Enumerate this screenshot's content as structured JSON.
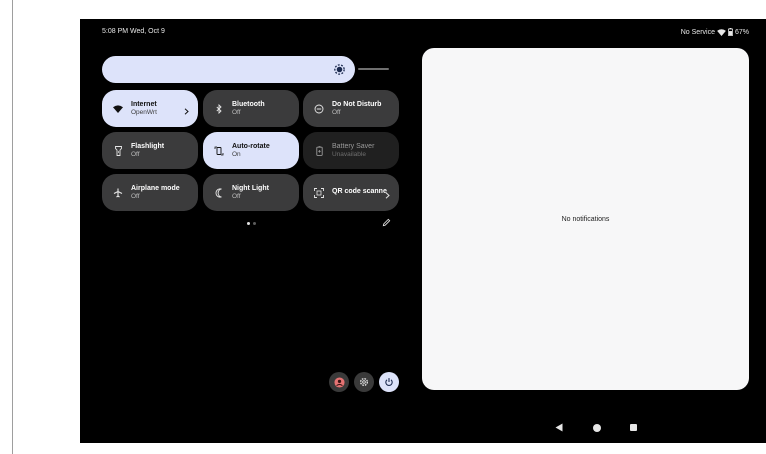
{
  "status_bar": {
    "time_date": "5:08 PM  Wed, Oct 9",
    "network": "No Service",
    "battery_percent": "67%",
    "battery_level": 0.67
  },
  "brightness": {
    "level": 0.97,
    "icon": "brightness-icon"
  },
  "tiles": [
    {
      "label": "Internet",
      "state": "OpenWrt",
      "icon": "wifi-icon",
      "active": true,
      "has_chevron": true
    },
    {
      "label": "Bluetooth",
      "state": "Off",
      "icon": "bluetooth-icon",
      "active": false
    },
    {
      "label": "Do Not Disturb",
      "state": "Off",
      "icon": "do-not-disturb-icon",
      "active": false
    },
    {
      "label": "Flashlight",
      "state": "Off",
      "icon": "flashlight-icon",
      "active": false
    },
    {
      "label": "Auto-rotate",
      "state": "On",
      "icon": "auto-rotate-icon",
      "active": true
    },
    {
      "label": "Battery Saver",
      "state": "Unavailable",
      "icon": "battery-saver-icon",
      "active": false,
      "unavailable": true
    },
    {
      "label": "Airplane mode",
      "state": "Off",
      "icon": "airplane-icon",
      "active": false
    },
    {
      "label": "Night Light",
      "state": "Off",
      "icon": "night-light-icon",
      "active": false
    },
    {
      "label": "QR code scanne",
      "state": "",
      "icon": "qr-code-icon",
      "active": false,
      "has_chevron": true
    }
  ],
  "pager": {
    "pages": 2,
    "current": 1
  },
  "actions": {
    "edit": "edit-icon",
    "user": "user-icon",
    "settings": "settings-icon",
    "power": "power-icon"
  },
  "notifications": {
    "empty_text": "No notifications"
  },
  "colors": {
    "active_tile": "#dde3fa",
    "inactive_tile": "#3b3b3c",
    "unavailable_tile": "#202020",
    "panel": "#f7f7f8",
    "user_button": "#e57373"
  }
}
